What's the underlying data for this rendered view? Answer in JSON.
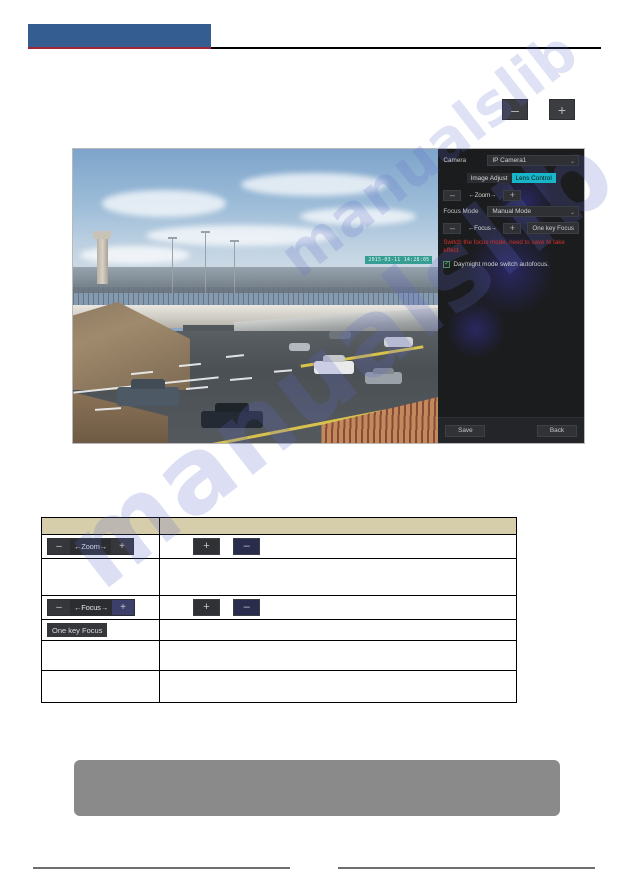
{
  "document": {
    "watermark": "manualslib",
    "watermark_small": "manualslib"
  },
  "header": {
    "bar_color": "#345d92",
    "accent_color": "#a32638",
    "title": ""
  },
  "top_controls": {
    "minus_label": "–",
    "plus_label": "+"
  },
  "screenshot": {
    "video": {
      "timestamp_overlay": "2015-03-11 14:28:05",
      "scene": "highway-overpass"
    },
    "panel": {
      "camera_label": "Camera",
      "camera_value": "IP Camera1",
      "chevron": "⌄",
      "tabs": [
        {
          "label": "Image Adjust",
          "active": false
        },
        {
          "label": "Lens Control",
          "active": true
        }
      ],
      "zoom": {
        "minus": "–",
        "text": "←Zoom→",
        "plus": "+"
      },
      "focus_mode_label": "Focus Mode",
      "focus_mode_value": "Manual Mode",
      "focus": {
        "minus": "–",
        "text": "←Focus→",
        "plus": "+",
        "one_key_label": "One key Focus"
      },
      "warning": "Switch the focus mode, need to save to take effect.",
      "checkbox": {
        "checked": true,
        "check_glyph": "✓",
        "label": "Day/night mode switch autofocus."
      },
      "buttons": {
        "save": "Save",
        "back": "Back"
      },
      "accent_color": "#17b6c9",
      "warning_color": "#d0302a"
    }
  },
  "table": {
    "headers": [
      "",
      ""
    ],
    "rows": [
      {
        "widget_type": "chip",
        "chip": {
          "minus": "–",
          "text": "←Zoom→",
          "plus": "+"
        },
        "label": "",
        "desc_buttons": [
          {
            "glyph": "+",
            "variant": "plain"
          },
          {
            "glyph": "–",
            "variant": "second"
          }
        ],
        "desc_text": ""
      },
      {
        "widget_type": "none",
        "label": "",
        "desc_buttons": [],
        "desc_text": ""
      },
      {
        "widget_type": "chip-focus",
        "chip": {
          "minus": "–",
          "text": "←Focus→",
          "plus": "+"
        },
        "label": "",
        "desc_buttons": [
          {
            "glyph": "+",
            "variant": "plain"
          },
          {
            "glyph": "–",
            "variant": "second"
          }
        ],
        "desc_text": ""
      },
      {
        "widget_type": "onekey",
        "onekey_label": "One key Focus",
        "label": "",
        "desc_buttons": [],
        "desc_text": ""
      },
      {
        "widget_type": "none",
        "label": "",
        "desc_buttons": [],
        "desc_text": ""
      },
      {
        "widget_type": "none",
        "label": "",
        "desc_buttons": [],
        "desc_text": ""
      }
    ]
  },
  "note_box": {
    "text": "",
    "color": "#8a8a8a"
  },
  "footer": {
    "left_text": "",
    "right_text": ""
  }
}
